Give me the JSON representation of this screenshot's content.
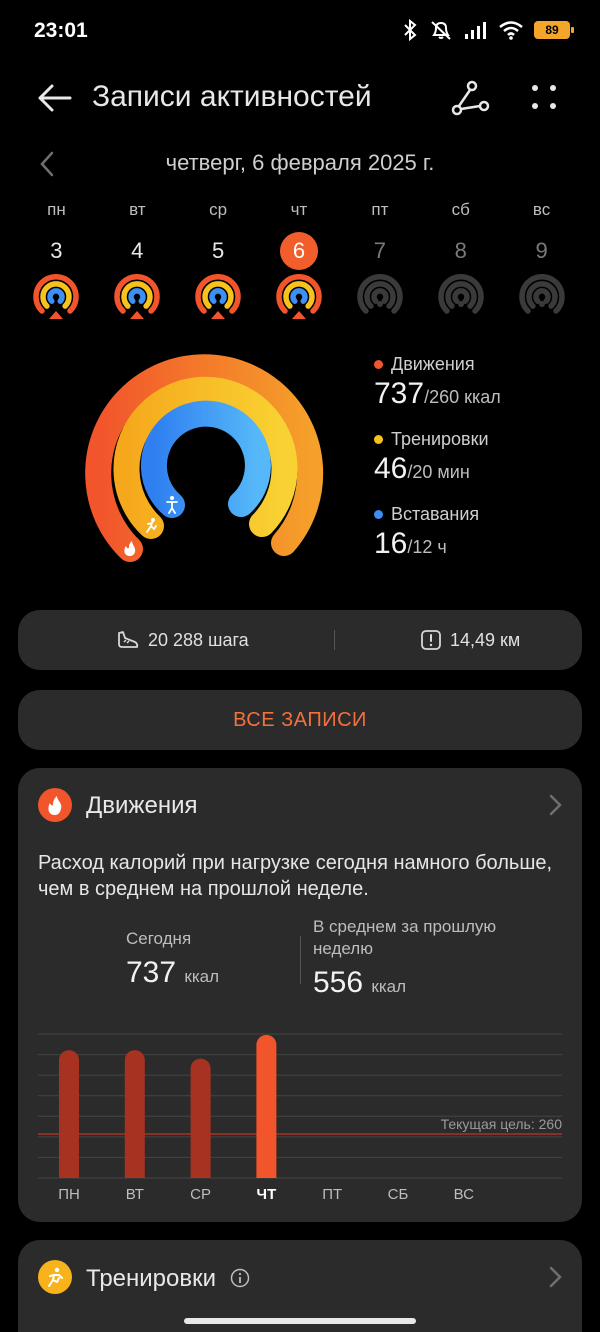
{
  "status_bar": {
    "time": "23:01",
    "battery": "89"
  },
  "header": {
    "title": "Записи активностей"
  },
  "date_nav": {
    "label": "четверг, 6 февраля 2025 г."
  },
  "week": [
    {
      "abbr": "пн",
      "num": "3",
      "state": "done"
    },
    {
      "abbr": "вт",
      "num": "4",
      "state": "done"
    },
    {
      "abbr": "ср",
      "num": "5",
      "state": "done"
    },
    {
      "abbr": "чт",
      "num": "6",
      "state": "today"
    },
    {
      "abbr": "пт",
      "num": "7",
      "state": "future"
    },
    {
      "abbr": "сб",
      "num": "8",
      "state": "future"
    },
    {
      "abbr": "вс",
      "num": "9",
      "state": "future"
    }
  ],
  "rings": {
    "colors": {
      "move": "#f2542b",
      "exercise": "#f7c21c",
      "stand": "#3c8ff5"
    },
    "legend": [
      {
        "key": "move",
        "title": "Движения",
        "value": "737",
        "goal": "/260 ккал"
      },
      {
        "key": "exercise",
        "title": "Тренировки",
        "value": "46",
        "goal": "/20 мин"
      },
      {
        "key": "stand",
        "title": "Вставания",
        "value": "16",
        "goal": "/12 ч"
      }
    ]
  },
  "stats": {
    "steps": "20 288 шага",
    "distance": "14,49 км"
  },
  "all_records": {
    "label": "ВСЕ ЗАПИСИ"
  },
  "move_card": {
    "title": "Движения",
    "summary": "Расход калорий при нагрузке сегодня намного больше, чем в среднем на прошлой неделе.",
    "today_label": "Сегодня",
    "today_value": "737",
    "today_unit": "ккал",
    "avg_label": "В среднем за прошлую неделю",
    "avg_value": "556",
    "avg_unit": "ккал"
  },
  "chart_data": {
    "type": "bar",
    "categories": [
      "ПН",
      "ВТ",
      "СР",
      "ЧТ",
      "ПТ",
      "СБ",
      "ВС"
    ],
    "values": [
      755,
      755,
      705,
      845,
      null,
      null,
      null
    ],
    "highlight_index": 3,
    "goal": 260,
    "goal_label": "Текущая цель: 260",
    "ylim": [
      0,
      850
    ],
    "grid": true,
    "colors": {
      "bar": "#a83222",
      "bar_today": "#f2542b",
      "goal_line": "#a83222"
    }
  },
  "train_card": {
    "title": "Тренировки"
  }
}
